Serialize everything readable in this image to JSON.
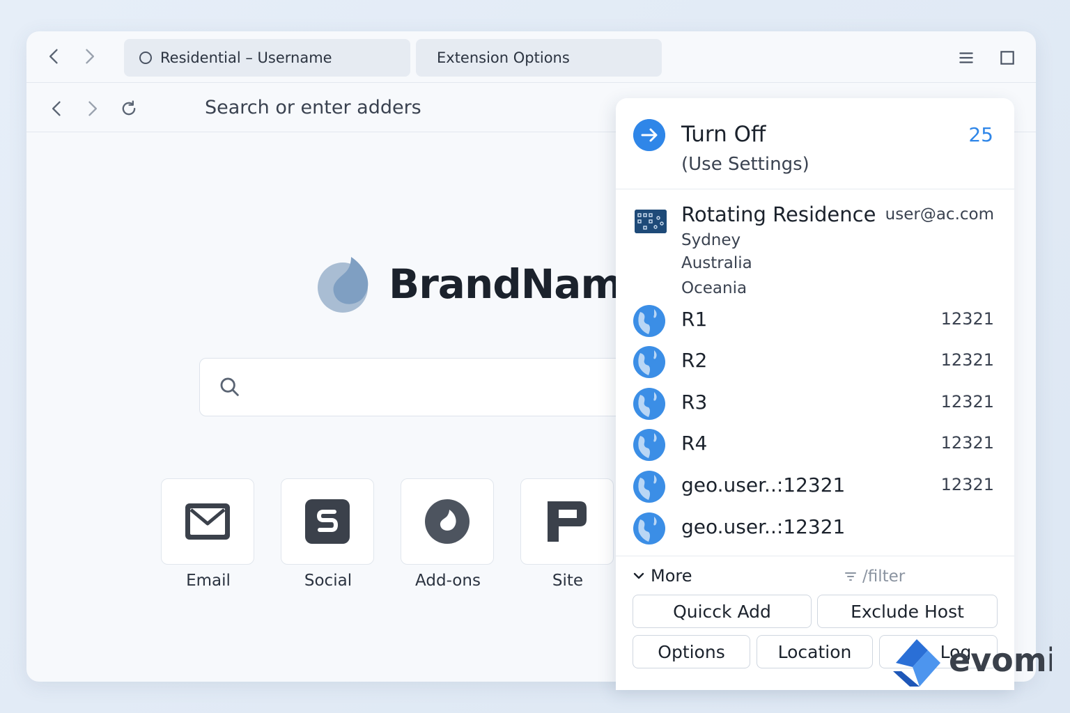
{
  "tabs": [
    {
      "label": "Residential – Username"
    },
    {
      "label": "Extension Options"
    }
  ],
  "address_bar": {
    "placeholder": "Search or enter adders"
  },
  "brand": {
    "name": "BrandName"
  },
  "shortcuts": [
    {
      "label": "Email",
      "icon": "mail-icon"
    },
    {
      "label": "Social",
      "icon": "social-s-icon"
    },
    {
      "label": "Add-ons",
      "icon": "addons-icon"
    },
    {
      "label": "Site",
      "icon": "site-p-icon"
    }
  ],
  "popup": {
    "turn_off": {
      "title": "Turn Off",
      "subtitle": "(Use Settings)",
      "count": "25"
    },
    "profile": {
      "name": "Rotating Residence",
      "user": "user@ac.com",
      "city": "Sydney",
      "country": "Australia",
      "region": "Oceania"
    },
    "servers": [
      {
        "name": "R1",
        "port": "12321"
      },
      {
        "name": "R2",
        "port": "12321"
      },
      {
        "name": "R3",
        "port": "12321"
      },
      {
        "name": "R4",
        "port": "12321"
      },
      {
        "name": "geo.user..:12321",
        "port": "12321"
      },
      {
        "name": "geo.user..:12321",
        "port": ""
      }
    ],
    "more_label": "More",
    "filter_hint": "/filter",
    "buttons": {
      "quick_add": "Quicck Add",
      "exclude_host": "Exclude Host",
      "options": "Options",
      "location": "Location",
      "log": "Log"
    }
  },
  "watermark": {
    "text": "evomi"
  },
  "colors": {
    "accent": "#2f86e8",
    "profile_icon": "#1e4a78"
  }
}
